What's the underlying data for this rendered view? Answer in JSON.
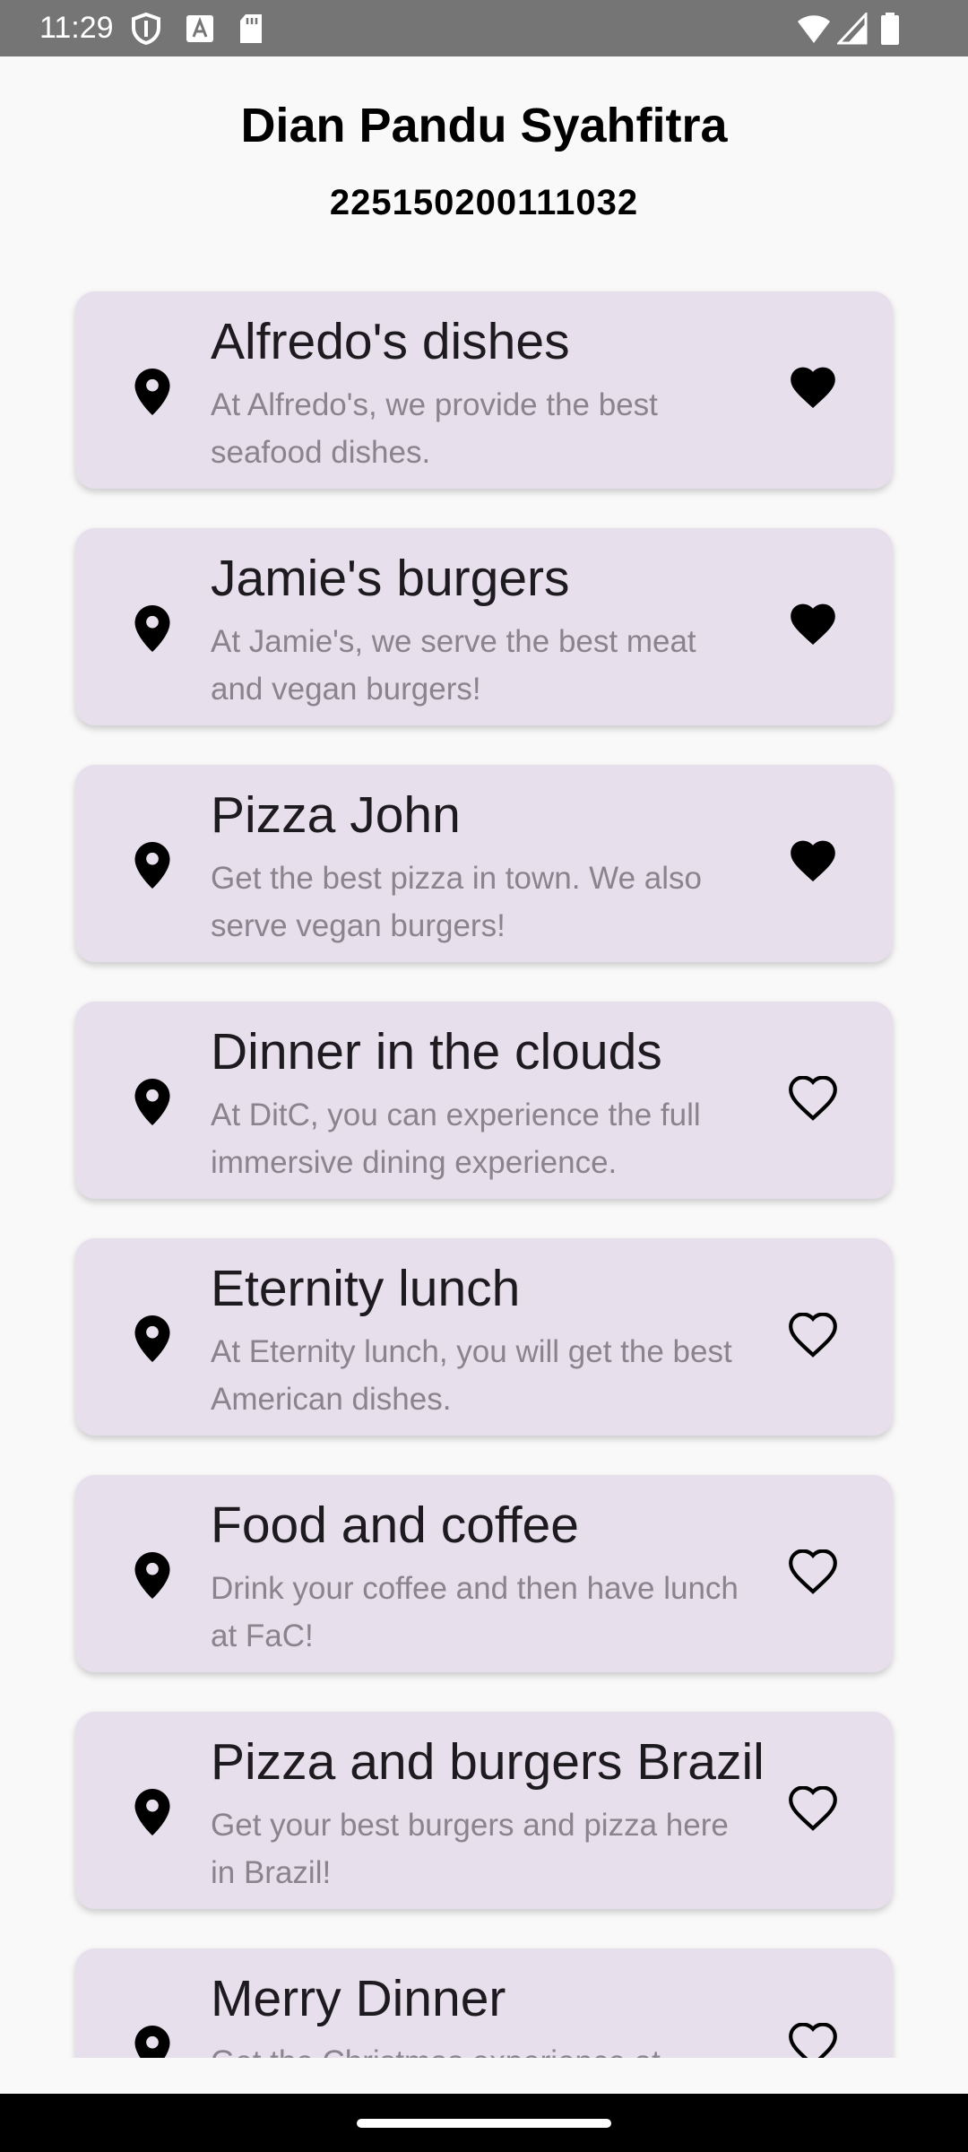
{
  "status_bar": {
    "time": "11:29",
    "left_icons": [
      "shield-icon",
      "text-a-icon",
      "sd-card-icon"
    ],
    "right_icons": [
      "wifi-icon",
      "cell-signal-icon",
      "battery-icon"
    ]
  },
  "header": {
    "name": "Dian Pandu Syahfitra",
    "student_id": "225150200111032"
  },
  "restaurants": [
    {
      "title": "Alfredo's dishes",
      "description": "At Alfredo's, we provide the best seafood dishes.",
      "favorite": true
    },
    {
      "title": "Jamie's burgers",
      "description": "At Jamie's, we serve the best meat and vegan burgers!",
      "favorite": true
    },
    {
      "title": "Pizza John",
      "description": "Get the best pizza in town. We also serve vegan burgers!",
      "favorite": true
    },
    {
      "title": "Dinner in the clouds",
      "description": "At DitC, you can experience the full immersive dining experience.",
      "favorite": false
    },
    {
      "title": "Eternity lunch",
      "description": "At Eternity lunch, you will get the best American dishes.",
      "favorite": false
    },
    {
      "title": "Food and coffee",
      "description": "Drink your coffee and then have lunch at FaC!",
      "favorite": false
    },
    {
      "title": "Pizza and burgers Brazil",
      "description": "Get your best burgers and pizza here in Brazil!",
      "favorite": false
    },
    {
      "title": "Merry Dinner",
      "description": "Get the Christmas experience at",
      "favorite": false
    }
  ],
  "colors": {
    "card_background": "#e7dfeb",
    "title_text": "#1d1b20",
    "description_text": "#8a848e",
    "status_bar": "#757575"
  }
}
